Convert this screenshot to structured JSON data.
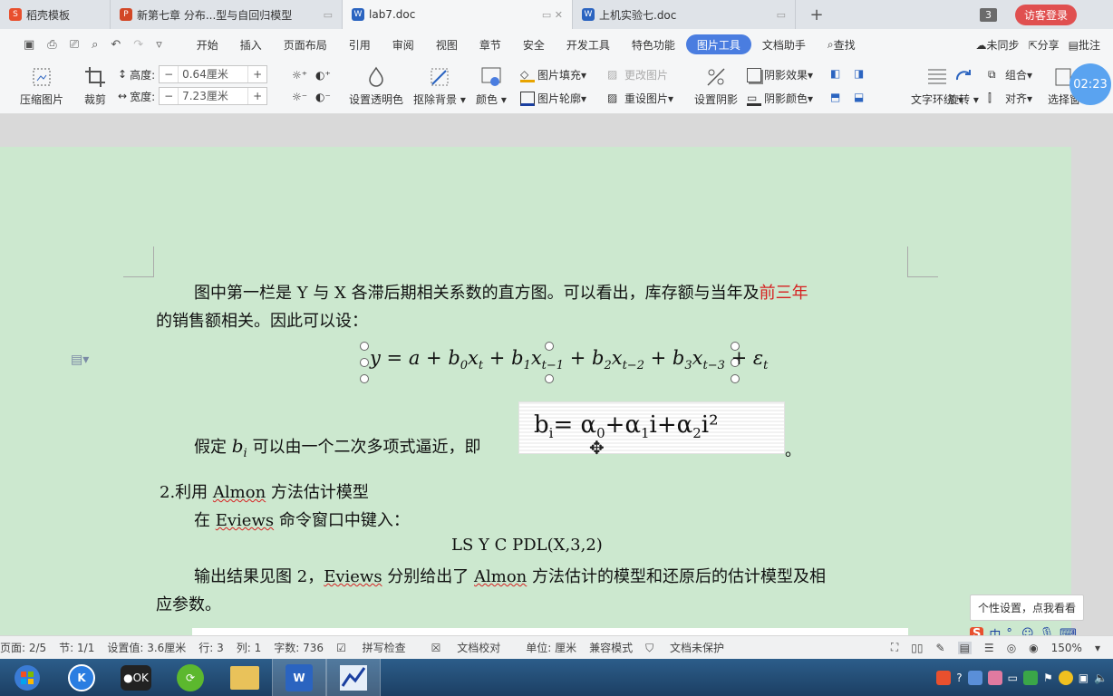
{
  "tabs": [
    {
      "label": "稻壳模板",
      "icon": "docer-icon",
      "color": "#e8502e"
    },
    {
      "label": "新第七章 分布...型与自回归模型",
      "icon": "ppt-icon",
      "color": "#d24726"
    },
    {
      "label": "lab7.doc",
      "icon": "word-doc-icon",
      "color": "#2b64c0",
      "active": true
    },
    {
      "label": "上机实验七.doc",
      "icon": "word-doc-icon",
      "color": "#2b64c0"
    }
  ],
  "window_count": "3",
  "login_label": "访客登录",
  "menu": {
    "items": [
      "开始",
      "插入",
      "页面布局",
      "引用",
      "审阅",
      "视图",
      "章节",
      "安全",
      "开发工具",
      "特色功能",
      "图片工具",
      "文档助手"
    ],
    "active": "图片工具",
    "search": "查找",
    "sync": "未同步",
    "share": "分享",
    "comment": "批注"
  },
  "ribbon": {
    "compress": "压缩图片",
    "crop": "裁剪",
    "height_label": "高度:",
    "height_value": "0.64厘米",
    "width_label": "宽度:",
    "width_value": "7.23厘米",
    "minus": "−",
    "plus": "+",
    "transparent": "设置透明色",
    "remove_bg": "抠除背景",
    "color": "颜色",
    "fill": "图片填充",
    "outline": "图片轮廓",
    "change_pic": "更改图片",
    "reset_pic": "重设图片",
    "shadow": "设置阴影",
    "shadow_effect": "阴影效果",
    "shadow_color": "阴影颜色",
    "wrap": "文字环绕",
    "rotate": "旋转",
    "group": "组合",
    "align": "对齐",
    "select": "选择窗",
    "timer": "02:23"
  },
  "doc": {
    "para1_a": "图中第一栏是 Y 与 X 各滞后期相关系数的直方图。可以看出，库存额与当年及",
    "para1_red": "前三年",
    "para1_b": "的销售额相关。因此可以设：",
    "eq_y": "y",
    "eq_a": "a",
    "eq_b0": "b",
    "eq_b0_sub": "0",
    "eq_x": "x",
    "eq_t": "t",
    "eq_b1_sub": "1",
    "eq_t1": "t−1",
    "eq_b2_sub": "2",
    "eq_t2": "t−2",
    "eq_b3_sub": "3",
    "eq_t3": "t−3",
    "eq_eps": "ε",
    "para2_a": "假定",
    "para2_b": "b",
    "para2_sub": "i",
    "para2_c": "可以由一个二次多项式逼近，即",
    "para2_end": "。",
    "formula_bi": "b",
    "formula_i": "i",
    "formula_eq": "= ",
    "formula_alpha": "α",
    "formula_0": "0",
    "formula_plus": "+",
    "formula_1": "1",
    "formula_iterm": "i",
    "formula_2": "2",
    "formula_isq": "i²",
    "heading": "2.利用 ",
    "almon": "Almon",
    "heading_b": " 方法估计模型",
    "cmd_a": "在 ",
    "eviews": "Eviews",
    "cmd_b": " 命令窗口中键入：",
    "command": "LS    Y    C    PDL(X,3,2)",
    "out_a": "输出结果见图 2，",
    "out_eviews": "Eviews",
    "out_b": " 分别给出了 ",
    "out_almon": "Almon",
    "out_c": " 方法估计的模型和还原后的估计模型及相",
    "out_d": "应参数。"
  },
  "tooltip": "个性设置，点我看看",
  "status": {
    "page": "页面: 2/5",
    "section": "节: 1/1",
    "setting": "设置值: 3.6厘米",
    "row": "行: 3",
    "col": "列: 1",
    "words": "字数: 736",
    "spell": "拼写检查",
    "proof": "文档校对",
    "unit": "单位: 厘米",
    "compat": "兼容模式",
    "protect": "文档未保护",
    "zoom": "150%"
  },
  "ime": {
    "lang": "中"
  }
}
